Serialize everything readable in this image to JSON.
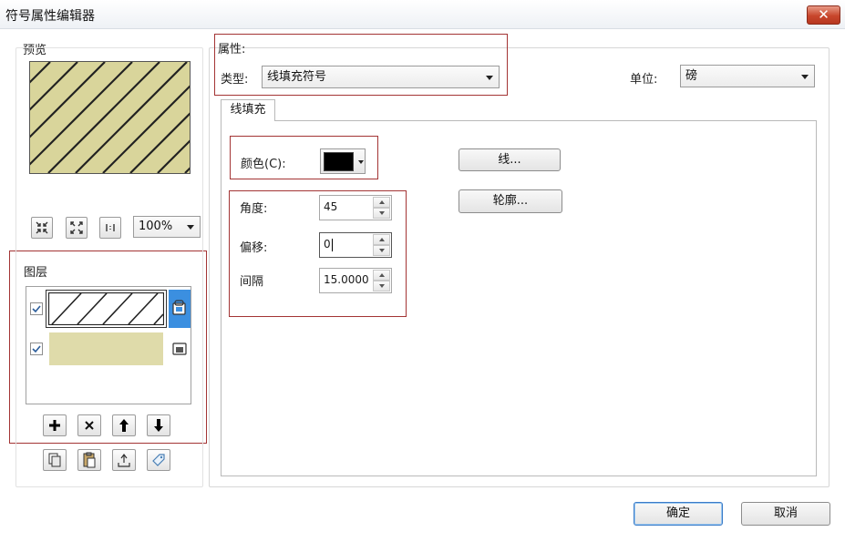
{
  "window": {
    "title": "符号属性编辑器",
    "close_label": "✕"
  },
  "preview": {
    "title": "预览",
    "fill_color": "#d9d59b",
    "line_color": "#222222",
    "zoom_value": "100%"
  },
  "layers": {
    "title": "图层",
    "items": [
      {
        "checked": true,
        "selected": true
      },
      {
        "checked": true,
        "selected": false,
        "fill_color": "#dfdbaa"
      }
    ]
  },
  "properties": {
    "title": "属性:",
    "type_label": "类型:",
    "type_value": "线填充符号",
    "unit_label": "单位:",
    "unit_value": "磅",
    "tab_label": "线填充",
    "color_label": "颜色(C):",
    "color_value": "#000000",
    "line_button": "线...",
    "outline_button": "轮廓...",
    "angle_label": "角度:",
    "angle_value": "45",
    "offset_label": "偏移:",
    "offset_value": "0",
    "spacing_label": "间隔",
    "spacing_value": "15.0000"
  },
  "footer": {
    "ok": "确定",
    "cancel": "取消"
  },
  "accent": {
    "red_highlight": "#a33434",
    "selection_blue": "#3b8fe0"
  }
}
